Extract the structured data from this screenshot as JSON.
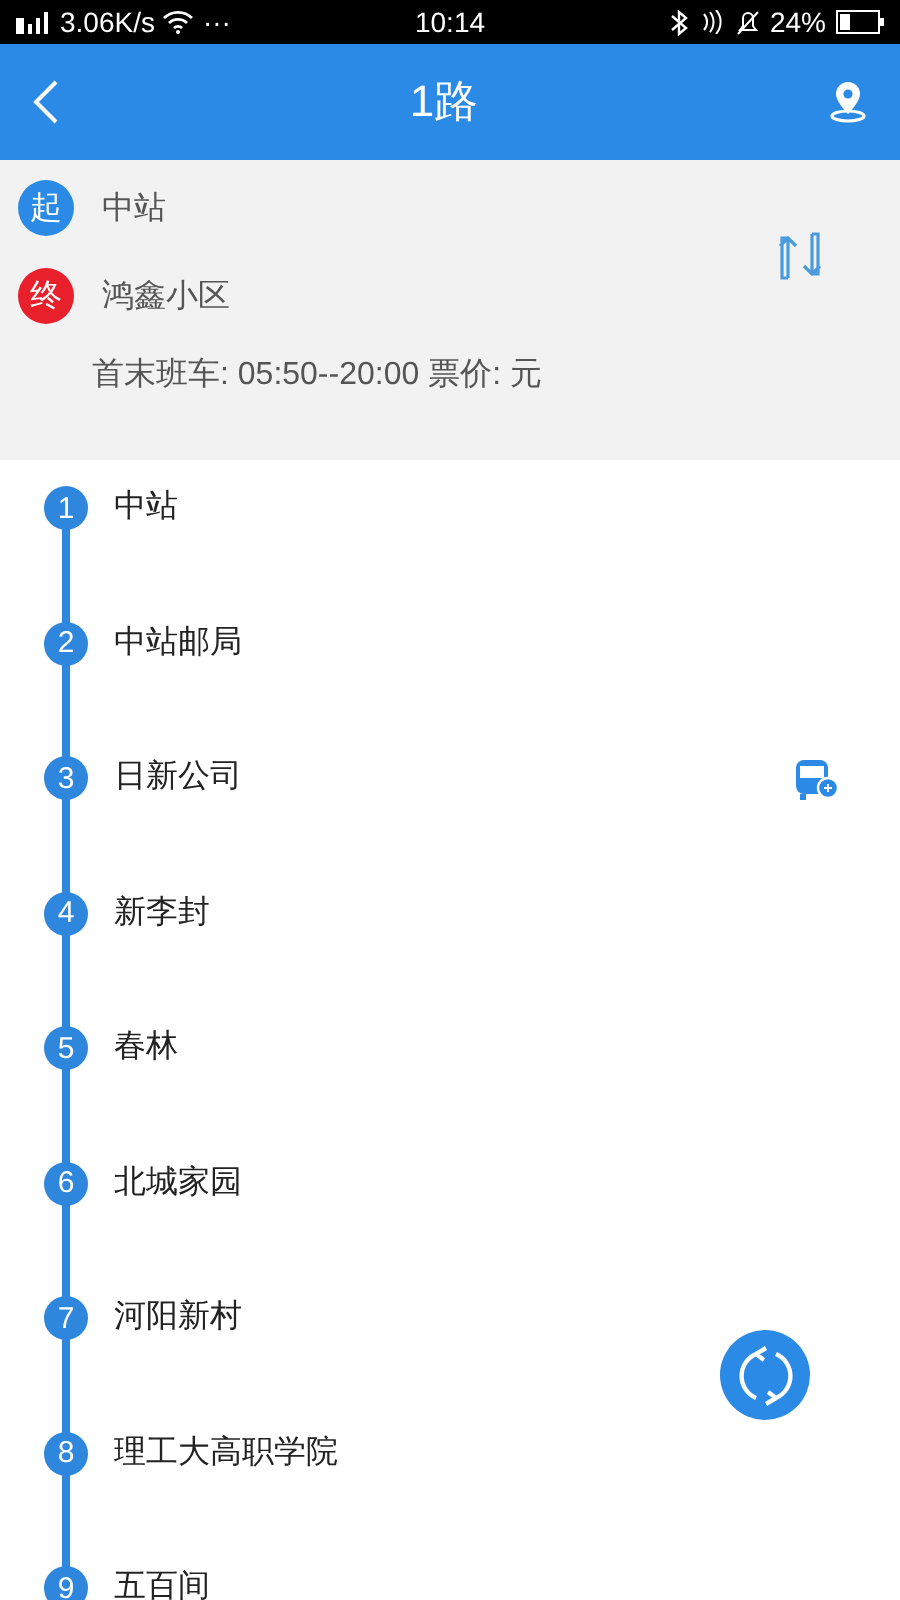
{
  "status_bar": {
    "speed": "3.06K/s",
    "more": "···",
    "time": "10:14",
    "battery": "24%"
  },
  "header": {
    "title": "1路"
  },
  "route": {
    "start_badge": "起",
    "start": "中站",
    "end_badge": "终",
    "end": "鸿鑫小区",
    "schedule": "首末班车: 05:50--20:00 票价:  元"
  },
  "stops": [
    {
      "number": "1",
      "name": "中站",
      "bus_here": false
    },
    {
      "number": "2",
      "name": "中站邮局",
      "bus_here": false
    },
    {
      "number": "3",
      "name": "日新公司",
      "bus_here": true
    },
    {
      "number": "4",
      "name": "新李封",
      "bus_here": false
    },
    {
      "number": "5",
      "name": "春林",
      "bus_here": false
    },
    {
      "number": "6",
      "name": "北城家园",
      "bus_here": false
    },
    {
      "number": "7",
      "name": "河阳新村",
      "bus_here": false
    },
    {
      "number": "8",
      "name": "理工大高职学院",
      "bus_here": false
    },
    {
      "number": "9",
      "name": "五百间",
      "bus_here": false
    }
  ]
}
